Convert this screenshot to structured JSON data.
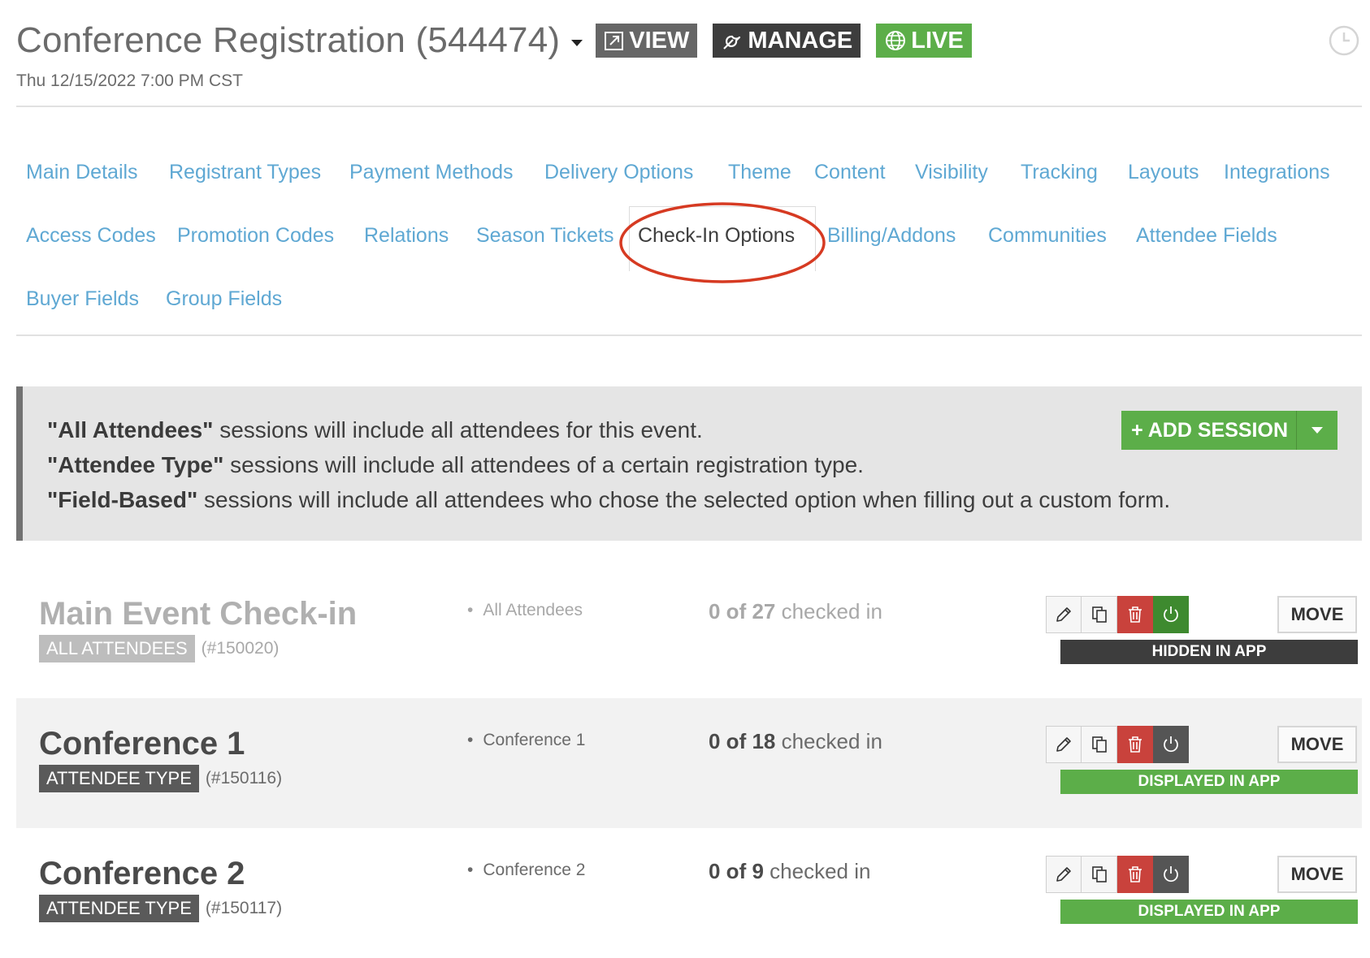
{
  "header": {
    "title": "Conference Registration (544474)",
    "subtitle": "Thu 12/15/2022 7:00 PM CST",
    "view_label": "VIEW",
    "manage_label": "MANAGE",
    "live_label": "LIVE",
    "colors": {
      "view": "#666666",
      "manage": "#3d3d3d",
      "live": "#5cae49"
    }
  },
  "tabs": [
    {
      "label": "Main Details"
    },
    {
      "label": "Registrant Types"
    },
    {
      "label": "Payment Methods"
    },
    {
      "label": "Delivery Options"
    },
    {
      "label": "Theme"
    },
    {
      "label": "Content"
    },
    {
      "label": "Visibility"
    },
    {
      "label": "Tracking"
    },
    {
      "label": "Layouts"
    },
    {
      "label": "Integrations"
    },
    {
      "label": "Access Codes"
    },
    {
      "label": "Promotion Codes"
    },
    {
      "label": "Relations"
    },
    {
      "label": "Season Tickets"
    },
    {
      "label": "Check-In Options",
      "active": true
    },
    {
      "label": "Billing/Addons"
    },
    {
      "label": "Communities"
    },
    {
      "label": "Attendee Fields"
    },
    {
      "label": "Buyer Fields"
    },
    {
      "label": "Group Fields"
    }
  ],
  "info": {
    "lines": [
      {
        "bold": "\"All Attendees\"",
        "text": " sessions will include all attendees for this event."
      },
      {
        "bold": "\"Attendee Type\"",
        "text": " sessions will include all attendees of a certain registration type."
      },
      {
        "bold": "\"Field-Based\"",
        "text": " sessions will include all attendees who chose the selected option when filling out a custom form."
      }
    ],
    "add_session_label": "+ ADD SESSION"
  },
  "sessions": [
    {
      "name": "Main Event Check-in",
      "type": "ALL ATTENDEES",
      "id": "(#150020)",
      "group": "All Attendees",
      "checked": "0 of 27",
      "checked_suffix": " checked in",
      "move_label": "MOVE",
      "status": "HIDDEN IN APP"
    },
    {
      "name": "Conference 1",
      "type": "ATTENDEE TYPE",
      "id": "(#150116)",
      "group": "Conference 1",
      "checked": "0 of 18",
      "checked_suffix": " checked in",
      "move_label": "MOVE",
      "status": "DISPLAYED IN APP"
    },
    {
      "name": "Conference 2",
      "type": "ATTENDEE TYPE",
      "id": "(#150117)",
      "group": "Conference 2",
      "checked": "0 of 9",
      "checked_suffix": " checked in",
      "move_label": "MOVE",
      "status": "DISPLAYED IN APP"
    }
  ],
  "icons": [
    "caret-down-icon",
    "external-link-icon",
    "wrench-icon",
    "globe-icon",
    "clock-icon",
    "pencil-icon",
    "copy-icon",
    "trash-icon",
    "power-icon"
  ]
}
